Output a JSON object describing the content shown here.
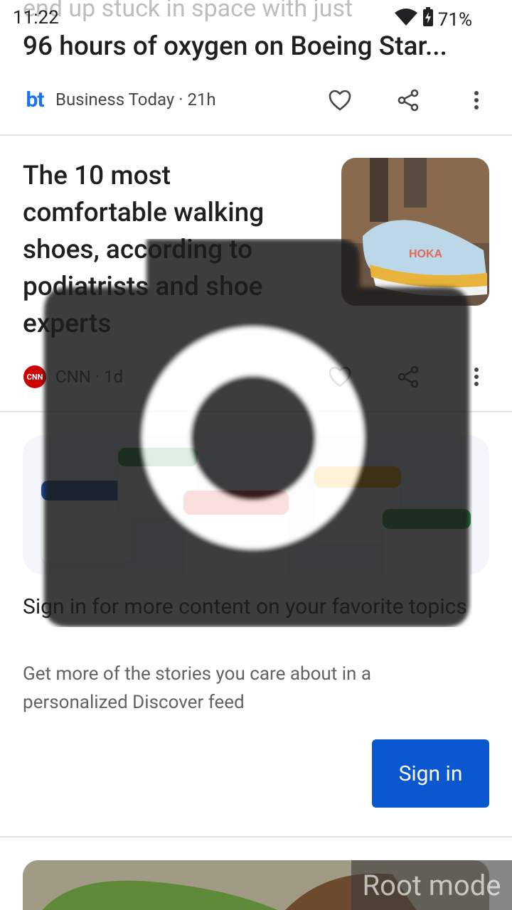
{
  "status_bar": {
    "time": "11:22",
    "battery": "71%",
    "wifi_icon": "wifi-icon",
    "battery_icon": "battery-charging-icon"
  },
  "feed": {
    "peek_title": "end up stuck in space with just",
    "cards": [
      {
        "headline": "96 hours of oxygen on Boeing Star...",
        "source": "Business Today · 21h",
        "logo_text": "bt",
        "logo_icon": "business-today-logo",
        "actions": [
          "heart-icon",
          "share-icon",
          "more-vert-icon"
        ]
      },
      {
        "headline": "The 10 most comfortable walking shoes, according to podiatrists and shoe experts",
        "source": "CNN · 1d",
        "logo_text": "CNN",
        "logo_icon": "cnn-logo",
        "thumb_icon": "shoe-thumbnail",
        "thumb_brand": "HOKA",
        "actions": [
          "heart-icon",
          "share-icon",
          "more-vert-icon"
        ]
      }
    ]
  },
  "signin_promo": {
    "title": "Sign in for more content on your favorite topics",
    "description": "Get more of the stories you care about in a personalized Discover feed",
    "button_label": "Sign in"
  },
  "overlay": {
    "icon": "camera-icon"
  },
  "root_badge": "Root mode",
  "colors": {
    "accent": "#0b57d0",
    "bt_blue": "#1a73e8",
    "cnn_red": "#cc0000",
    "google_blue": "#1a4fa0",
    "google_green": "#1e8e3e",
    "google_red": "#d93025",
    "google_yellow": "#f9ab00"
  }
}
